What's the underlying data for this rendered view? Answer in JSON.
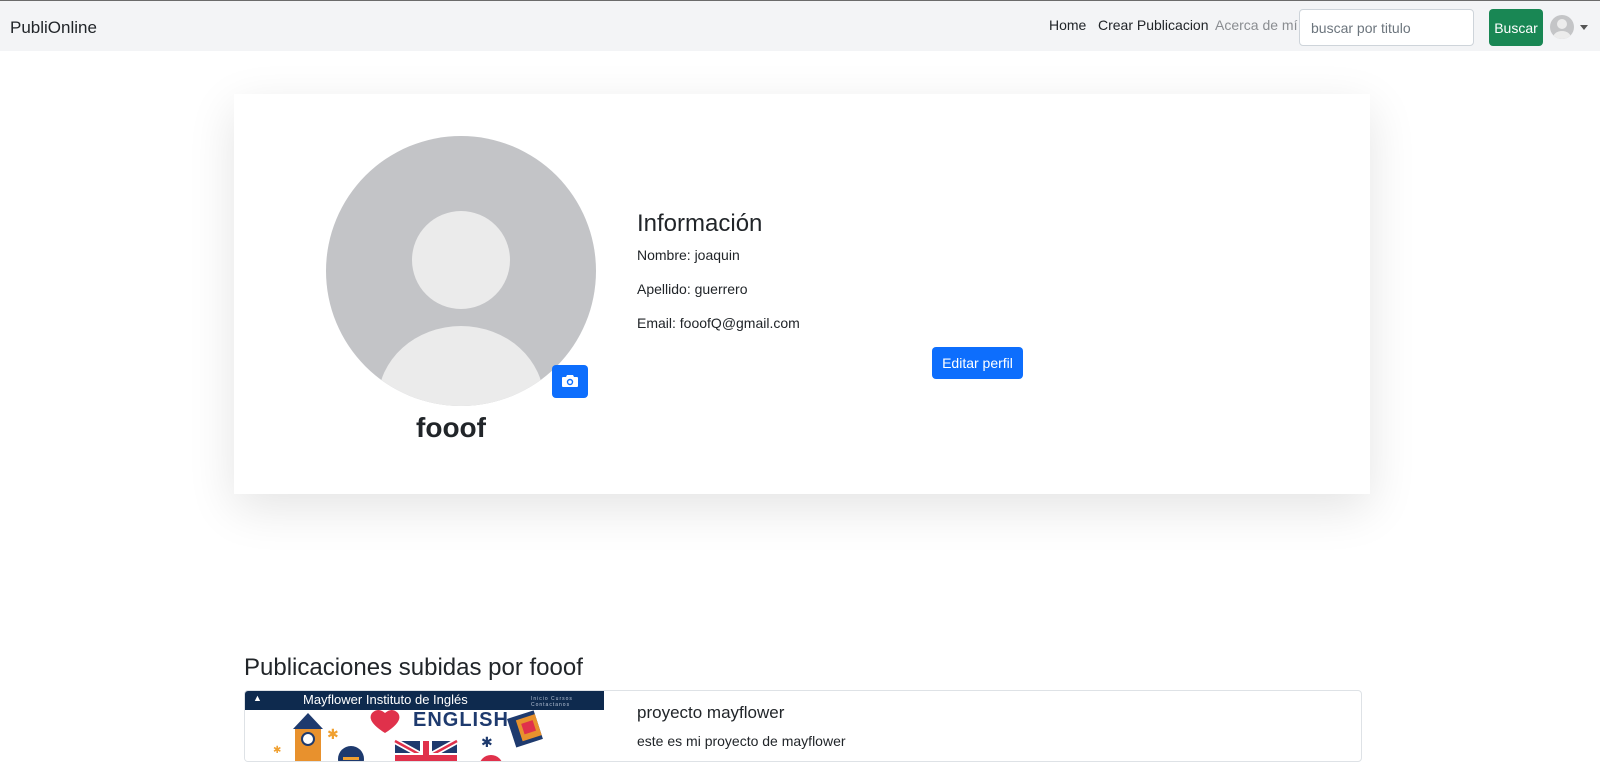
{
  "navbar": {
    "brand": "PubliOnline",
    "links": [
      "Home",
      "Crear Publicacion",
      "Acerca de mí"
    ],
    "search_placeholder": "buscar por titulo",
    "search_button": "Buscar"
  },
  "profile": {
    "username": "fooof",
    "info_title": "Información",
    "nombre": "Nombre: joaquin",
    "apellido": "Apellido: guerrero",
    "email": "Email: fooofQ@gmail.com",
    "edit_button": "Editar perfil"
  },
  "publications": {
    "heading": "Publicaciones subidas por fooof",
    "items": [
      {
        "thumb_header": "Mayflower Instituto de Inglés",
        "thumb_nav": "Inicio  Cursos  Contactanos",
        "thumb_text": "ENGLISH",
        "title": "proyecto mayflower",
        "description": "este es mi proyecto de mayflower"
      }
    ]
  },
  "colors": {
    "primary": "#0d6efd",
    "success": "#198754",
    "navbar_bg": "#f3f4f6"
  }
}
